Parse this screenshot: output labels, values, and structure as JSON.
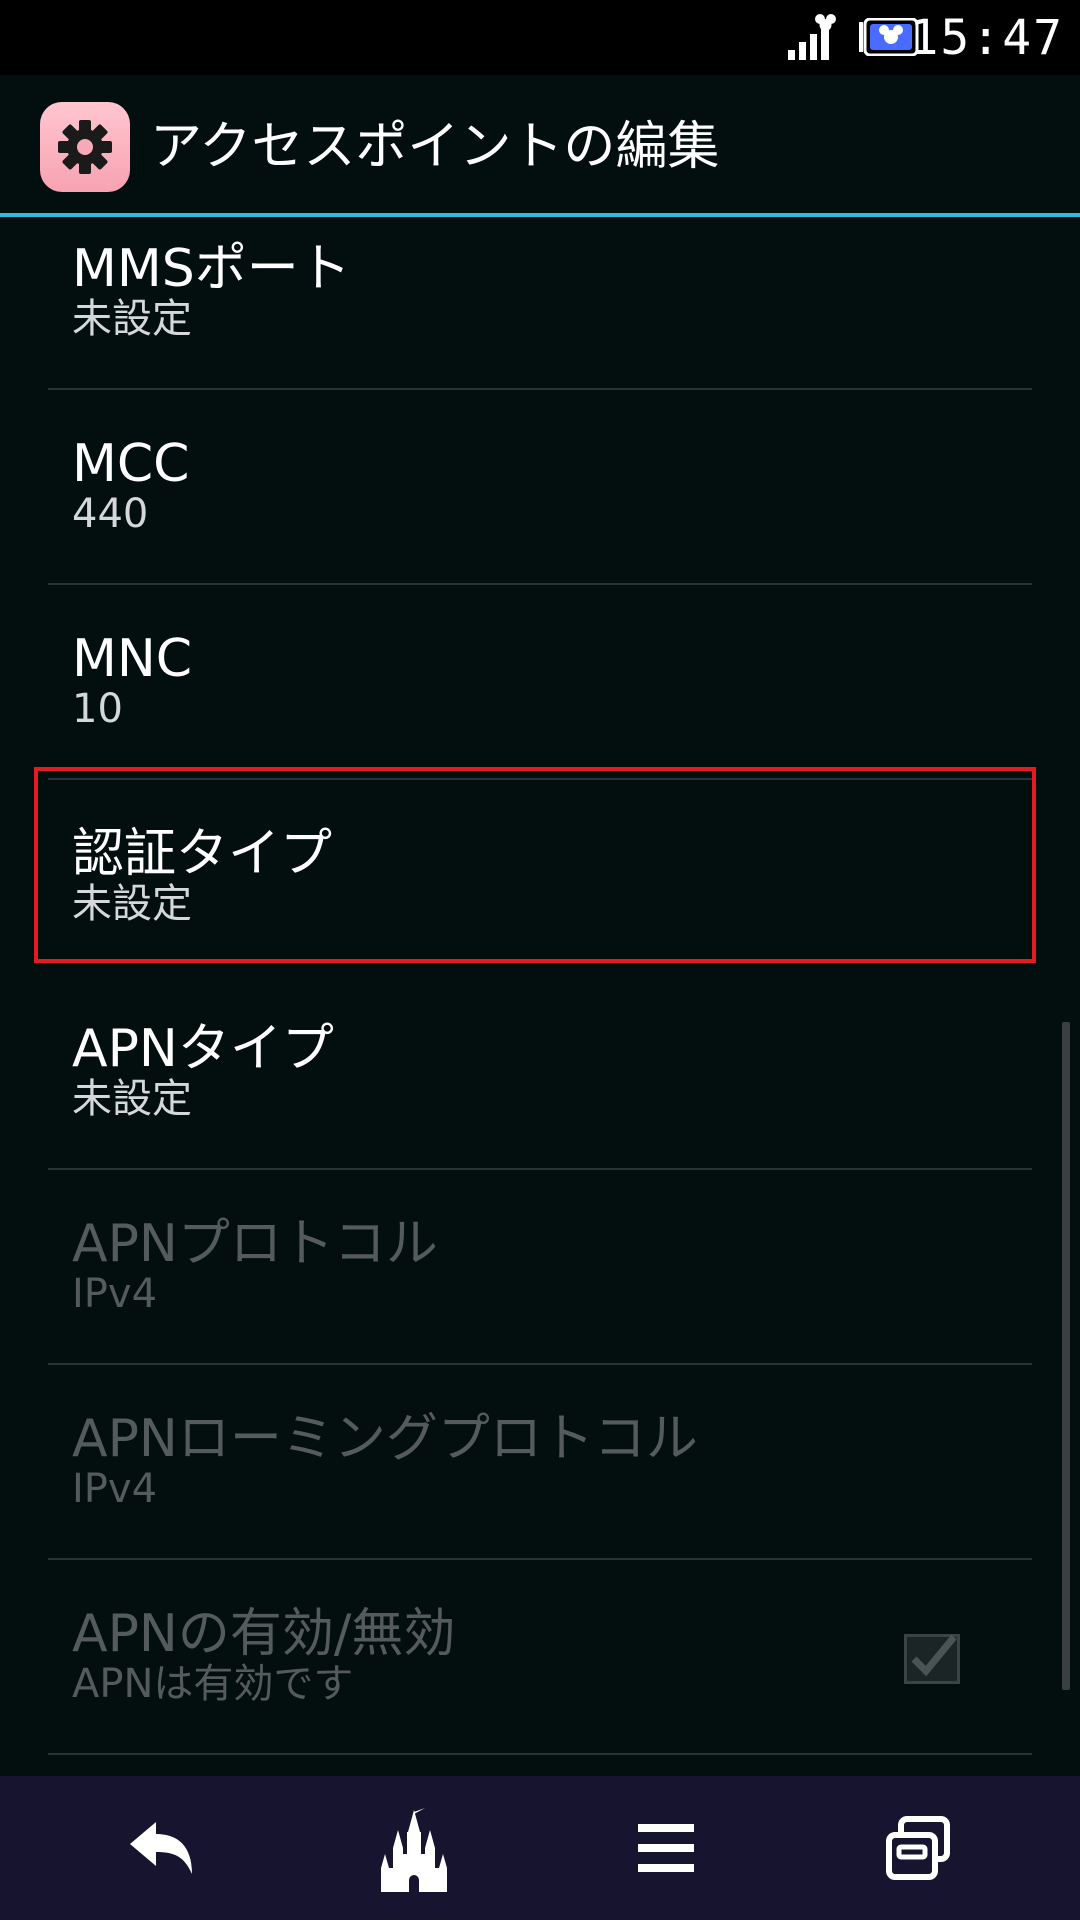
{
  "status_bar": {
    "time": "15:47",
    "icons": [
      "signal-icon",
      "battery-icon"
    ]
  },
  "action_bar": {
    "title": "アクセスポイントの編集",
    "icon": "settings-gear-icon",
    "accent_color": "#33b5e5"
  },
  "items": [
    {
      "title": "MMSポート",
      "summary": "未設定",
      "enabled": true
    },
    {
      "title": "MCC",
      "summary": "440",
      "enabled": true
    },
    {
      "title": "MNC",
      "summary": "10",
      "enabled": true
    },
    {
      "title": "認証タイプ",
      "summary": "未設定",
      "enabled": true,
      "highlighted": true
    },
    {
      "title": "APNタイプ",
      "summary": "未設定",
      "enabled": true
    },
    {
      "title": "APNプロトコル",
      "summary": "IPv4",
      "enabled": false
    },
    {
      "title": "APNローミングプロトコル",
      "summary": "IPv4",
      "enabled": false
    },
    {
      "title": "APNの有効/無効",
      "summary": "APNは有効です",
      "enabled": false,
      "checkbox": true,
      "checked": true
    }
  ],
  "nav_bar": {
    "buttons": [
      "back-icon",
      "home-castle-icon",
      "menu-icon",
      "recent-apps-icon"
    ]
  },
  "colors": {
    "background": "#030e0f",
    "highlight_border": "#e31c23",
    "nav_background": "#16142e"
  }
}
